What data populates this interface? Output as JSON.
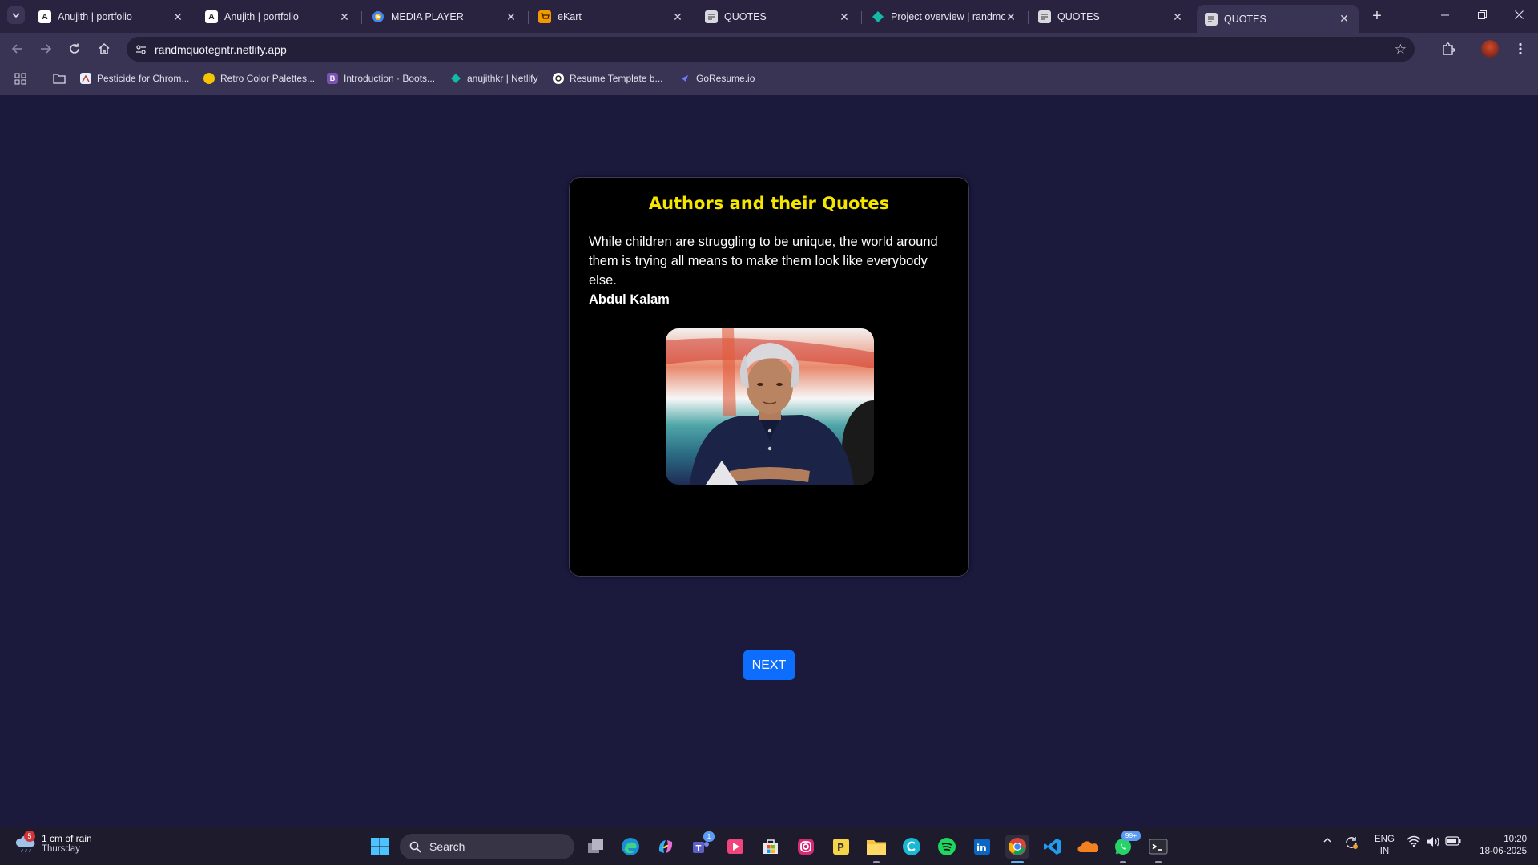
{
  "browser": {
    "tabs": [
      {
        "label": "Anujith | portfolio",
        "icon": "A",
        "icon_color": "#ffffff"
      },
      {
        "label": "Anujith | portfolio",
        "icon": "A",
        "icon_color": "#ffffff"
      },
      {
        "label": "MEDIA PLAYER",
        "icon": "",
        "icon_color": "#4285f4"
      },
      {
        "label": "eKart",
        "icon": "",
        "icon_color": "#f29900"
      },
      {
        "label": "QUOTES",
        "icon": "",
        "icon_color": "#d8d8e0"
      },
      {
        "label": "Project overview | randmo",
        "icon": "",
        "icon_color": "#14b8a6"
      },
      {
        "label": "QUOTES",
        "icon": "",
        "icon_color": "#d8d8e0"
      },
      {
        "label": "QUOTES",
        "icon": "",
        "icon_color": "#d8d8e0"
      }
    ],
    "active_tab": 7,
    "url": "randmquotegntr.netlify.app",
    "bookmarks": [
      {
        "label": "Pesticide for Chrom...",
        "icon_color": "#e8f0fe"
      },
      {
        "label": "Retro Color Palettes...",
        "icon_color": "#f5c400"
      },
      {
        "label": "Introduction · Boots...",
        "icon": "B",
        "icon_color": "#7952b3"
      },
      {
        "label": "anujithkr | Netlify",
        "icon_color": "#14b8a6"
      },
      {
        "label": "Resume Template b...",
        "icon_color": "#ffffff"
      },
      {
        "label": "GoResume.io",
        "icon_color": "#6b7cff"
      }
    ]
  },
  "page": {
    "heading": "Authors and their Quotes",
    "quote": "While children are struggling to be unique, the world around them is trying all means to make them look like everybody else.",
    "author": "Abdul Kalam",
    "next_label": "NEXT",
    "colors": {
      "heading": "#f5e600",
      "background": "#1b1a3d",
      "card": "#000000",
      "button": "#0d6efd"
    }
  },
  "taskbar": {
    "weather": {
      "badge": "5",
      "line1": "1 cm of rain",
      "line2": "Thursday"
    },
    "search_label": "Search",
    "teams_badge": "1",
    "whatsapp_badge": "99+",
    "lang_line1": "ENG",
    "lang_line2": "IN",
    "time": "10:20",
    "date": "18-06-2025"
  }
}
